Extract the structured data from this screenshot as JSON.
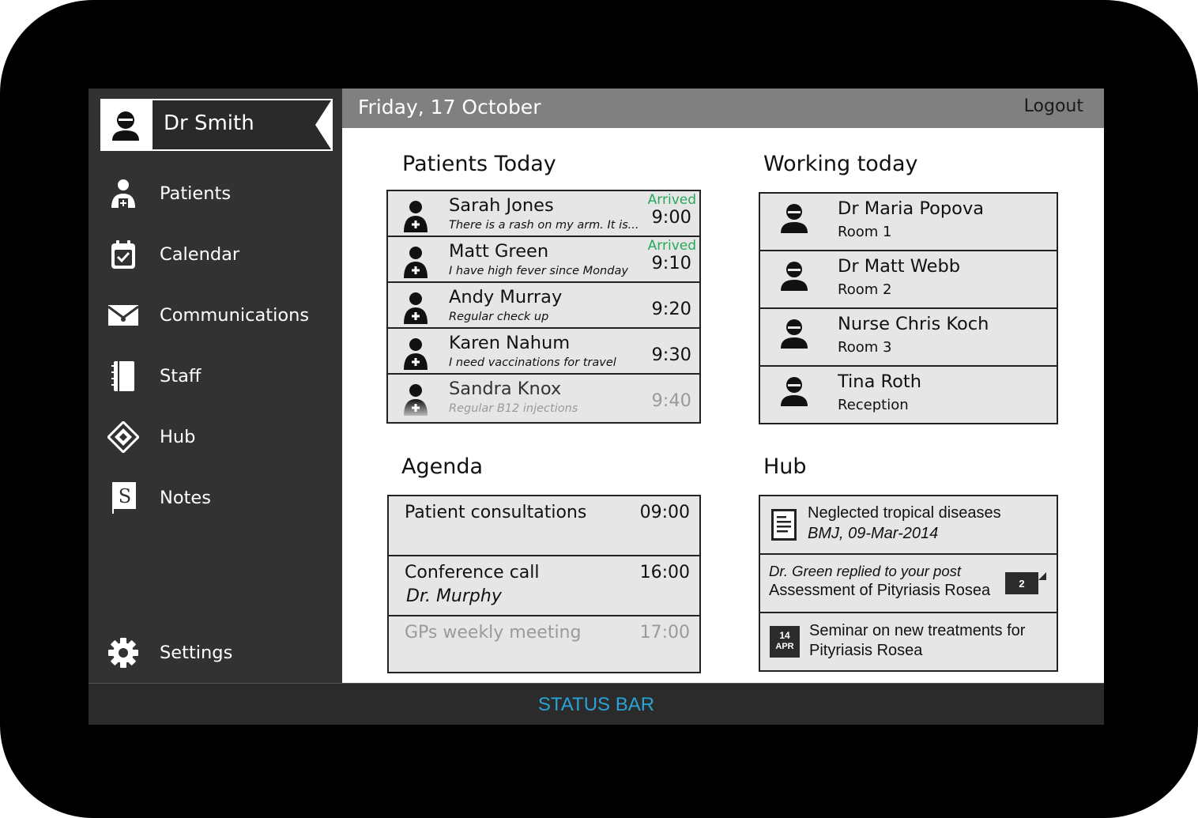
{
  "user": {
    "name": "Dr Smith",
    "avatar_icon": "user-avatar-icon"
  },
  "nav": [
    {
      "label": "Patients",
      "icon": "patient-add-icon"
    },
    {
      "label": "Calendar",
      "icon": "calendar-check-icon"
    },
    {
      "label": "Communications",
      "icon": "envelope-icon"
    },
    {
      "label": "Staff",
      "icon": "notebook-icon"
    },
    {
      "label": "Hub",
      "icon": "hub-diamond-icon"
    },
    {
      "label": "Notes",
      "icon": "notes-s-icon"
    }
  ],
  "settings": {
    "label": "Settings",
    "icon": "gear-icon"
  },
  "topbar": {
    "date": "Friday, 17 October",
    "logout": "Logout"
  },
  "patients": {
    "title": "Patients Today",
    "items": [
      {
        "name": "Sarah Jones",
        "note": "There is a rash on my arm. It is...",
        "time": "9:00",
        "status": "Arrived"
      },
      {
        "name": "Matt Green",
        "note": "I have high fever since Monday",
        "time": "9:10",
        "status": "Arrived"
      },
      {
        "name": "Andy Murray",
        "note": "Regular check up",
        "time": "9:20",
        "status": ""
      },
      {
        "name": "Karen Nahum",
        "note": "I need vaccinations for travel",
        "time": "9:30",
        "status": ""
      },
      {
        "name": "Sandra Knox",
        "note": "Regular B12 injections",
        "time": "9:40",
        "status": ""
      }
    ]
  },
  "working": {
    "title": "Working today",
    "items": [
      {
        "name": "Dr Maria Popova",
        "room": "Room 1"
      },
      {
        "name": "Dr Matt Webb",
        "room": "Room 2"
      },
      {
        "name": "Nurse Chris Koch",
        "room": "Room 3"
      },
      {
        "name": "Tina Roth",
        "room": "Reception"
      }
    ]
  },
  "agenda": {
    "title": "Agenda",
    "items": [
      {
        "title": "Patient consultations",
        "sub": "",
        "time": "09:00"
      },
      {
        "title": "Conference call",
        "sub": "Dr. Murphy",
        "time": "16:00"
      },
      {
        "title": "GPs weekly meeting",
        "sub": "",
        "time": "17:00"
      }
    ]
  },
  "hub": {
    "title": "Hub",
    "article": {
      "title": "Neglected tropical diseases",
      "source": "BMJ, 09-Mar-2014",
      "icon": "document-icon"
    },
    "reply": {
      "line1": "Dr. Green replied to your post",
      "line2": "Assessment of Pityriasis Rosea",
      "count": "2"
    },
    "event": {
      "line1": "Seminar on new treatments for",
      "line2": "Pityriasis Rosea",
      "day": "14",
      "month": "APR"
    }
  },
  "status_bar": {
    "text": "STATUS BAR",
    "color": "#29a3d6"
  },
  "colors": {
    "sidebar": "#323232",
    "topbar": "#808080",
    "row": "#e6e6e6",
    "arrived": "#27a85a"
  }
}
